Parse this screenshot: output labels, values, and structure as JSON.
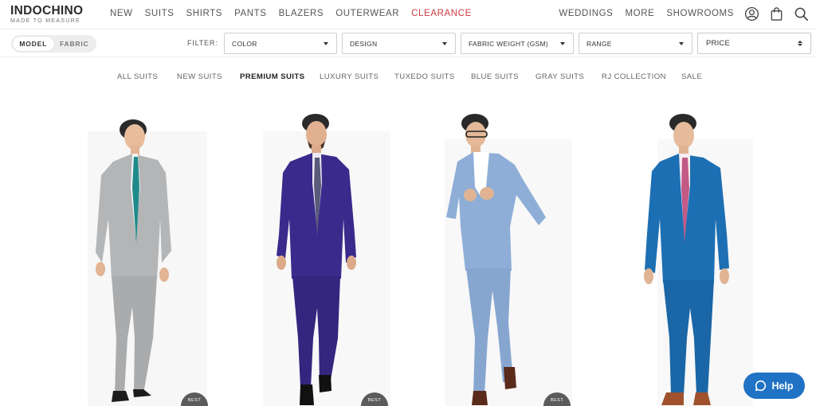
{
  "brand": {
    "name": "INDOCHINO",
    "tagline": "MADE TO MEASURE"
  },
  "main_nav": [
    {
      "label": "NEW"
    },
    {
      "label": "SUITS"
    },
    {
      "label": "SHIRTS"
    },
    {
      "label": "PANTS"
    },
    {
      "label": "BLAZERS"
    },
    {
      "label": "OUTERWEAR"
    },
    {
      "label": "CLEARANCE"
    }
  ],
  "right_nav": [
    {
      "label": "WEDDINGS"
    },
    {
      "label": "MORE"
    },
    {
      "label": "SHOWROOMS"
    }
  ],
  "header_icons": [
    "account-icon",
    "shopping-bag-icon",
    "search-icon"
  ],
  "view_toggle": {
    "options": [
      "MODEL",
      "FABRIC"
    ],
    "selected": "MODEL"
  },
  "filters": {
    "label": "FILTER:",
    "dropdowns": [
      {
        "label": "COLOR"
      },
      {
        "label": "DESIGN"
      },
      {
        "label": "FABRIC WEIGHT (GSM)"
      },
      {
        "label": "RANGE"
      }
    ],
    "sort": {
      "label": "PRICE"
    }
  },
  "categories": [
    {
      "label": "ALL SUITS"
    },
    {
      "label": "NEW SUITS"
    },
    {
      "label": "PREMIUM SUITS"
    },
    {
      "label": "LUXURY SUITS"
    },
    {
      "label": "TUXEDO SUITS"
    },
    {
      "label": "BLUE SUITS"
    },
    {
      "label": "GRAY SUITS"
    },
    {
      "label": "RJ COLLECTION"
    },
    {
      "label": "SALE"
    }
  ],
  "active_category": "PREMIUM SUITS",
  "products": [
    {
      "suit_color": "#b3b5b7",
      "tie_color": "#1f8a8a",
      "shoe_color": "#1c1c1c",
      "badge": "BEST"
    },
    {
      "suit_color": "#3a2a8c",
      "tie_color": "#5a5a7a",
      "shoe_color": "#111111",
      "badge": "BEST"
    },
    {
      "suit_color": "#8eaed8",
      "tie_color": "",
      "shoe_color": "#5a2a1a",
      "badge": "BEST"
    },
    {
      "suit_color": "#1d6fb3",
      "tie_color": "#c25a86",
      "shoe_color": "#a0522d",
      "badge": ""
    }
  ],
  "help": {
    "label": "Help"
  },
  "colors": {
    "clearance": "#d0393e",
    "help_button": "#1f72c4",
    "text": "#333333"
  }
}
